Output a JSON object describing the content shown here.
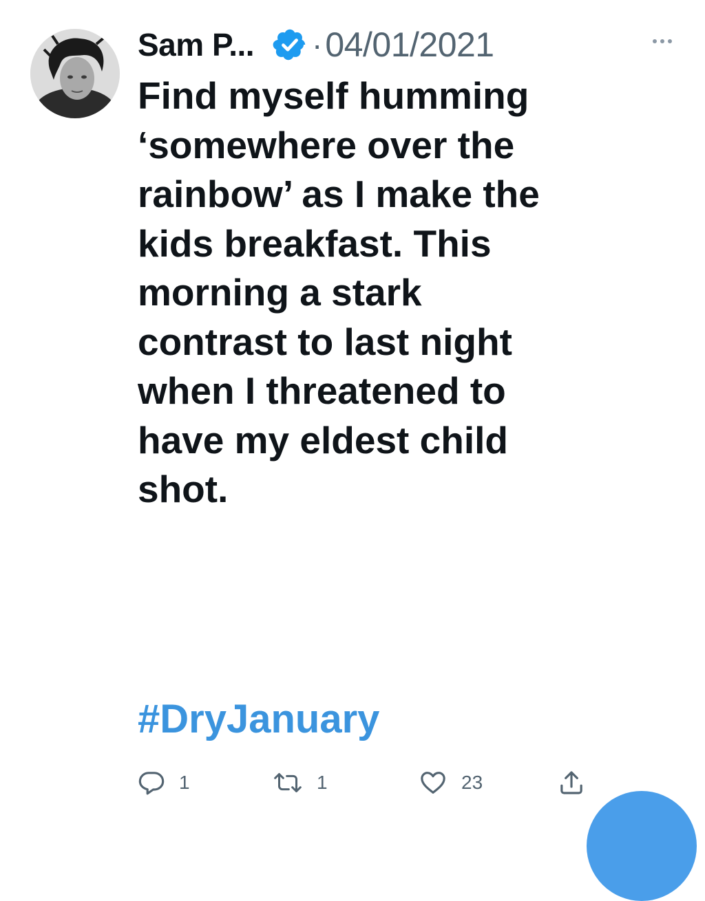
{
  "tweet": {
    "author": "Sam P...",
    "separator": "·",
    "date": "04/01/2021",
    "text_lines": [
      "Find myself humming",
      "‘somewhere over the",
      "rainbow’ as I make the",
      "kids breakfast. This",
      "morning a stark",
      "contrast to last night",
      "when I threatened to",
      "have my eldest child",
      "shot."
    ],
    "hashtag": "#DryJanuary"
  },
  "actions": {
    "reply_count": "1",
    "retweet_count": "1",
    "like_count": "23"
  },
  "icons": {
    "verified": "verified-badge-icon",
    "more": "more-options-icon",
    "reply": "reply-icon",
    "retweet": "retweet-icon",
    "like": "heart-icon",
    "share": "share-icon"
  },
  "colors": {
    "text": "#0f1419",
    "secondary": "#536471",
    "hashtag": "#3b94de",
    "verified": "#1d9bf0",
    "fab": "#4a9eea"
  }
}
